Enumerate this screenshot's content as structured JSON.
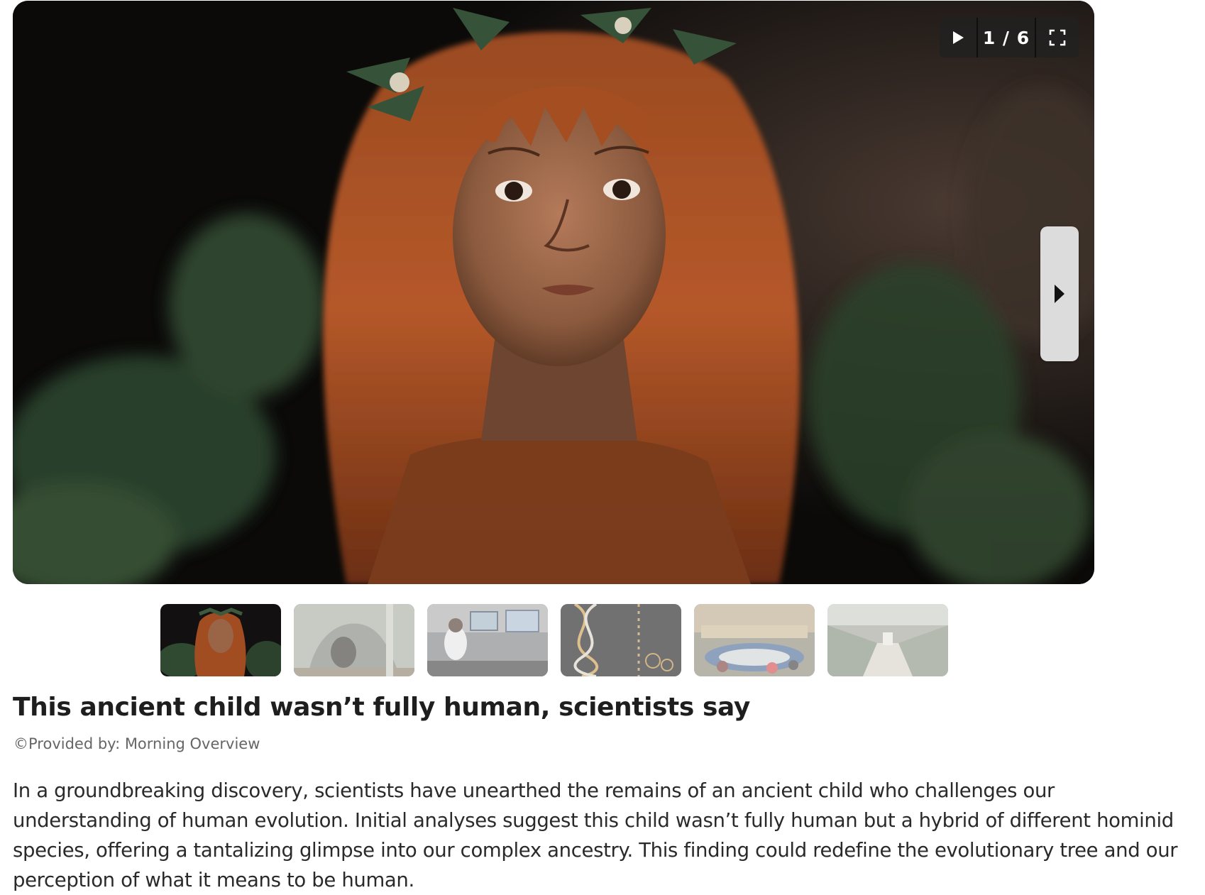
{
  "slideshow": {
    "image_alt": "Reconstruction of an ancient child with long red hair and a leaf crown",
    "counter": "1 / 6",
    "controls": {
      "play_icon": "play-icon",
      "fullscreen_icon": "fullscreen-icon",
      "next_icon": "chevron-right-icon"
    },
    "thumbnails": [
      {
        "subject": "ancient child portrait",
        "selected": true
      },
      {
        "subject": "cave entrance"
      },
      {
        "subject": "scientist in laboratory"
      },
      {
        "subject": "DNA double helix"
      },
      {
        "subject": "scientific conference hall"
      },
      {
        "subject": "laboratory interior"
      }
    ]
  },
  "article": {
    "headline": "This ancient child wasn’t fully human, scientists say",
    "provider": "©Provided by: Morning Overview",
    "body": "In a groundbreaking discovery, scientists have unearthed the remains of an ancient child who challenges our understanding of human evolution. Initial analyses suggest this child wasn’t fully human but a hybrid of different hominid species, offering a tantalizing glimpse into our complex ancestry. This finding could redefine the evolutionary tree and our perception of what it means to be human."
  },
  "colors": {
    "control_bar": "#1c1c1c",
    "next_button": "#dcdcdc",
    "headline": "#1e1e1e",
    "provider": "#666666"
  }
}
